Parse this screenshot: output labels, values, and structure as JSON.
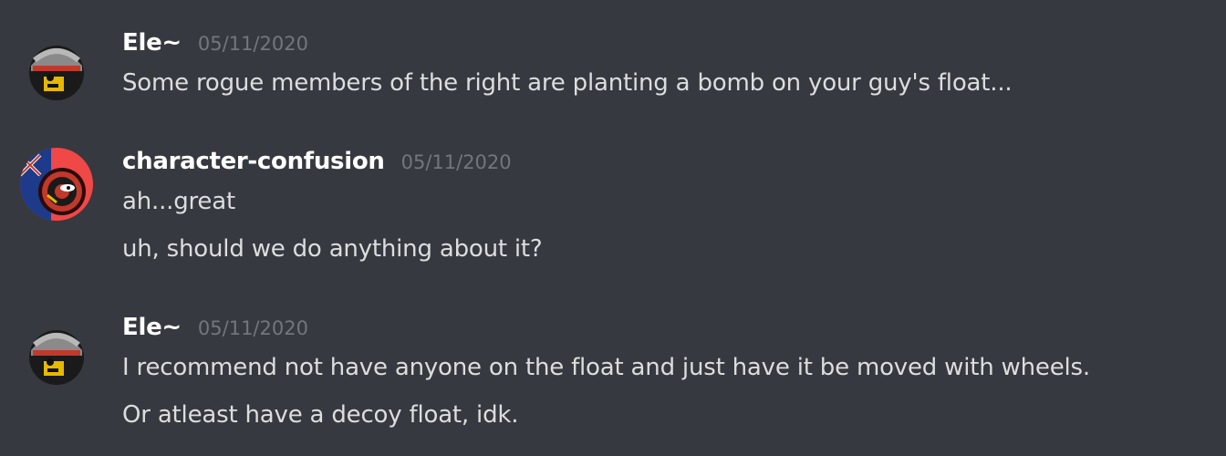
{
  "messages": [
    {
      "author": "Ele~",
      "timestamp": "05/11/2020",
      "avatar": "soldier-ball-avatar",
      "lines": [
        "Some rogue members of the right are planting a bomb on your guy's float..."
      ]
    },
    {
      "author": "character-confusion",
      "timestamp": "05/11/2020",
      "avatar": "countryball-avatar",
      "lines": [
        "ah...great",
        "uh, should we do anything about it?"
      ]
    },
    {
      "author": "Ele~",
      "timestamp": "05/11/2020",
      "avatar": "soldier-ball-avatar",
      "lines": [
        "I recommend not have anyone on the float and just have it be moved with wheels.",
        "Or atleast have a decoy float, idk."
      ]
    }
  ],
  "colors": {
    "background": "#36393f",
    "username": "#ffffff",
    "timestamp": "#72767d",
    "message_text": "#dcddde"
  }
}
